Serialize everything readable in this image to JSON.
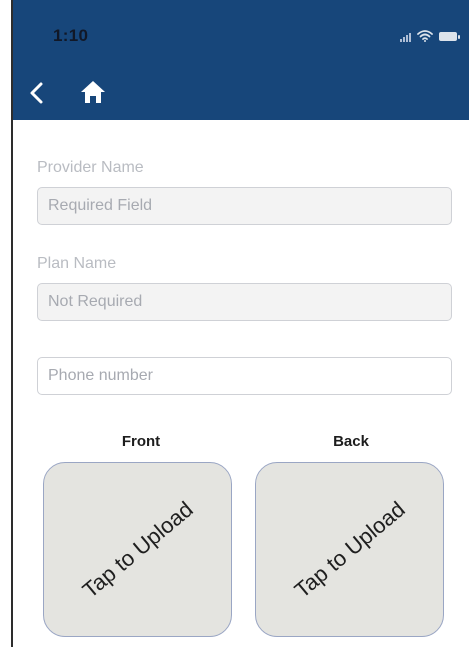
{
  "status_bar": {
    "time": "1:10"
  },
  "nav": {
    "back_icon": "chevron-left-icon",
    "home_icon": "home-icon"
  },
  "form": {
    "provider_name": {
      "label": "Provider Name",
      "placeholder": "Required Field"
    },
    "plan_name": {
      "label": "Plan Name",
      "placeholder": "Not Required"
    },
    "phone_number": {
      "placeholder": "Phone number"
    }
  },
  "cards": {
    "front": {
      "label": "Front",
      "action": "Tap to Upload"
    },
    "back": {
      "label": "Back",
      "action": "Tap to Upload"
    }
  },
  "colors": {
    "header": "#17467a",
    "upload_box": "#e4e4e0",
    "upload_border": "#9aa6c4"
  }
}
